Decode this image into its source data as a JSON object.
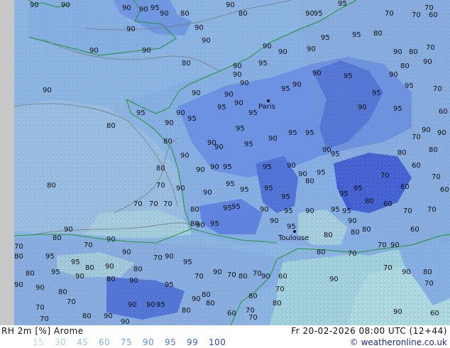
{
  "header": {
    "title": "RH 2m [%] Arome",
    "timestamp": "Fr 20-02-2026 08:00 UTC (12+44)"
  },
  "legend": {
    "ticks": [
      {
        "label": "15",
        "color": "#b4e0e8"
      },
      {
        "label": "30",
        "color": "#a8d2e2"
      },
      {
        "label": "45",
        "color": "#98c4dc"
      },
      {
        "label": "60",
        "color": "#86b4e4"
      },
      {
        "label": "75",
        "color": "#74a4e8"
      },
      {
        "label": "90",
        "color": "#5e8ce8"
      },
      {
        "label": "95",
        "color": "#4a74e0"
      },
      {
        "label": "99",
        "color": "#3a5cd8"
      },
      {
        "label": "100",
        "color": "#2c44cc"
      }
    ]
  },
  "credit": {
    "text": "© weatheronline.co.uk"
  },
  "map": {
    "colors": {
      "sea": "#8cb6e6",
      "land_low": "#a6d2e0",
      "land_mid": "#86b0e6",
      "land_high": "#5e86e6",
      "land_max": "#3e5fd8",
      "coast": "#1a9a2a",
      "contour": "#808080"
    },
    "cities": [
      {
        "name": "Paris"
      },
      {
        "name": "Toulouse"
      }
    ],
    "contour_labels": [
      {
        "text": "90"
      },
      {
        "text": "90"
      },
      {
        "text": "90"
      },
      {
        "text": "90"
      },
      {
        "text": "95"
      },
      {
        "text": "90"
      },
      {
        "text": "80"
      },
      {
        "text": "90"
      },
      {
        "text": "80"
      },
      {
        "text": "90"
      },
      {
        "text": "90"
      },
      {
        "text": "90"
      },
      {
        "text": "95"
      },
      {
        "text": "95"
      },
      {
        "text": "70"
      },
      {
        "text": "70"
      },
      {
        "text": "60"
      },
      {
        "text": "70"
      },
      {
        "text": "80"
      },
      {
        "text": "90"
      },
      {
        "text": "90"
      },
      {
        "text": "90"
      },
      {
        "text": "90"
      },
      {
        "text": "90"
      },
      {
        "text": "95"
      },
      {
        "text": "95"
      },
      {
        "text": "80"
      },
      {
        "text": "90"
      },
      {
        "text": "90"
      },
      {
        "text": "90"
      },
      {
        "text": "90"
      },
      {
        "text": "80"
      },
      {
        "text": "70"
      },
      {
        "text": "90"
      },
      {
        "text": "90"
      },
      {
        "text": "95"
      },
      {
        "text": "90"
      },
      {
        "text": "90"
      },
      {
        "text": "80"
      },
      {
        "text": "95"
      },
      {
        "text": "90"
      },
      {
        "text": "95"
      },
      {
        "text": "90"
      },
      {
        "text": "80"
      },
      {
        "text": "90"
      },
      {
        "text": "95"
      },
      {
        "text": "90"
      },
      {
        "text": "95"
      },
      {
        "text": "95"
      },
      {
        "text": "90"
      },
      {
        "text": "80"
      },
      {
        "text": "90"
      },
      {
        "text": "95"
      },
      {
        "text": "90"
      },
      {
        "text": "95"
      },
      {
        "text": "95"
      },
      {
        "text": "90"
      },
      {
        "text": "90"
      },
      {
        "text": "95"
      },
      {
        "text": "95"
      },
      {
        "text": "90"
      },
      {
        "text": "90"
      },
      {
        "text": "80"
      },
      {
        "text": "90"
      },
      {
        "text": "90"
      },
      {
        "text": "95"
      },
      {
        "text": "95"
      },
      {
        "text": "90"
      },
      {
        "text": "95"
      },
      {
        "text": "95"
      },
      {
        "text": "80"
      },
      {
        "text": "90"
      },
      {
        "text": "70"
      },
      {
        "text": "70"
      },
      {
        "text": "70"
      },
      {
        "text": "80"
      },
      {
        "text": "80"
      },
      {
        "text": "90"
      },
      {
        "text": "95"
      },
      {
        "text": "95"
      },
      {
        "text": "95"
      },
      {
        "text": "95"
      },
      {
        "text": "95"
      },
      {
        "text": "90"
      },
      {
        "text": "90"
      },
      {
        "text": "95"
      },
      {
        "text": "95"
      },
      {
        "text": "90"
      },
      {
        "text": "95"
      },
      {
        "text": "90"
      },
      {
        "text": "70"
      },
      {
        "text": "90"
      },
      {
        "text": "95"
      },
      {
        "text": "95"
      },
      {
        "text": "90"
      },
      {
        "text": "95"
      },
      {
        "text": "90"
      },
      {
        "text": "95"
      },
      {
        "text": "95"
      },
      {
        "text": "80"
      },
      {
        "text": "95"
      },
      {
        "text": "90"
      },
      {
        "text": "95"
      },
      {
        "text": "80"
      },
      {
        "text": "80"
      },
      {
        "text": "70"
      },
      {
        "text": "90"
      },
      {
        "text": "95"
      },
      {
        "text": "80"
      },
      {
        "text": "70"
      },
      {
        "text": "60"
      },
      {
        "text": "70"
      },
      {
        "text": "70"
      },
      {
        "text": "80"
      },
      {
        "text": "70"
      },
      {
        "text": "80"
      },
      {
        "text": "60"
      },
      {
        "text": "70"
      },
      {
        "text": "80"
      },
      {
        "text": "90"
      },
      {
        "text": "70"
      },
      {
        "text": "90"
      },
      {
        "text": "90"
      },
      {
        "text": "80"
      },
      {
        "text": "95"
      },
      {
        "text": "95"
      },
      {
        "text": "80"
      },
      {
        "text": "90"
      },
      {
        "text": "80"
      },
      {
        "text": "95"
      },
      {
        "text": "90"
      },
      {
        "text": "80"
      },
      {
        "text": "70"
      },
      {
        "text": "90"
      },
      {
        "text": "95"
      },
      {
        "text": "90"
      },
      {
        "text": "90"
      },
      {
        "text": "80"
      },
      {
        "text": "80"
      },
      {
        "text": "90"
      },
      {
        "text": "95"
      },
      {
        "text": "70"
      },
      {
        "text": "80"
      },
      {
        "text": "90"
      },
      {
        "text": "70"
      },
      {
        "text": "80"
      },
      {
        "text": "70"
      },
      {
        "text": "90"
      },
      {
        "text": "70"
      },
      {
        "text": "70"
      },
      {
        "text": "80"
      },
      {
        "text": "60"
      },
      {
        "text": "70"
      },
      {
        "text": "70"
      },
      {
        "text": "60"
      },
      {
        "text": "70"
      },
      {
        "text": "80"
      },
      {
        "text": "90"
      },
      {
        "text": "90"
      },
      {
        "text": "90"
      },
      {
        "text": "95"
      },
      {
        "text": "90"
      },
      {
        "text": "80"
      },
      {
        "text": "90"
      },
      {
        "text": "80"
      },
      {
        "text": "80"
      },
      {
        "text": "70"
      },
      {
        "text": "90"
      },
      {
        "text": "70"
      },
      {
        "text": "90"
      },
      {
        "text": "80"
      },
      {
        "text": "90"
      },
      {
        "text": "70"
      },
      {
        "text": "60"
      },
      {
        "text": "80"
      },
      {
        "text": "70"
      },
      {
        "text": "60"
      },
      {
        "text": "60"
      },
      {
        "text": "60"
      },
      {
        "text": "70"
      },
      {
        "text": "80"
      },
      {
        "text": "90"
      },
      {
        "text": "90"
      },
      {
        "text": "60"
      },
      {
        "text": "70"
      },
      {
        "text": "60"
      },
      {
        "text": "80"
      },
      {
        "text": "90"
      },
      {
        "text": "70"
      },
      {
        "text": "70"
      },
      {
        "text": "90"
      },
      {
        "text": "80"
      }
    ]
  }
}
